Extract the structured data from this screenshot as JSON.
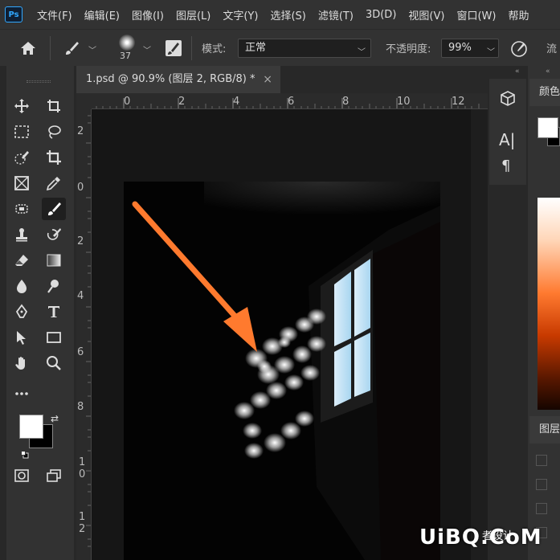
{
  "app": {
    "logo": "Ps"
  },
  "menu": [
    "文件(F)",
    "编辑(E)",
    "图像(I)",
    "图层(L)",
    "文字(Y)",
    "选择(S)",
    "滤镜(T)",
    "3D(D)",
    "视图(V)",
    "窗口(W)",
    "帮助"
  ],
  "options": {
    "brush_size": "37",
    "mode_label": "模式:",
    "mode_value": "正常",
    "opacity_label": "不透明度:",
    "opacity_value": "99%",
    "flow_label": "流"
  },
  "document": {
    "tab_title": "1.psd @ 90.9% (图层 2, RGB/8) *",
    "close": "×"
  },
  "rulers": {
    "top": [
      "0",
      "2",
      "4",
      "6",
      "8",
      "10",
      "12"
    ],
    "left": [
      "2",
      "0",
      "2",
      "4",
      "6",
      "8",
      "1\n0",
      "1\n2"
    ]
  },
  "panels": {
    "color_tab": "颜色",
    "layers_tab": "图层",
    "text_tool_label": "A|",
    "paragraph_label": "¶"
  },
  "watermark": {
    "text": "UiBQ.CoM",
    "small": "者设计"
  },
  "colors": {
    "arrow": "#ff7a2e",
    "accent": "#31a8ff"
  }
}
